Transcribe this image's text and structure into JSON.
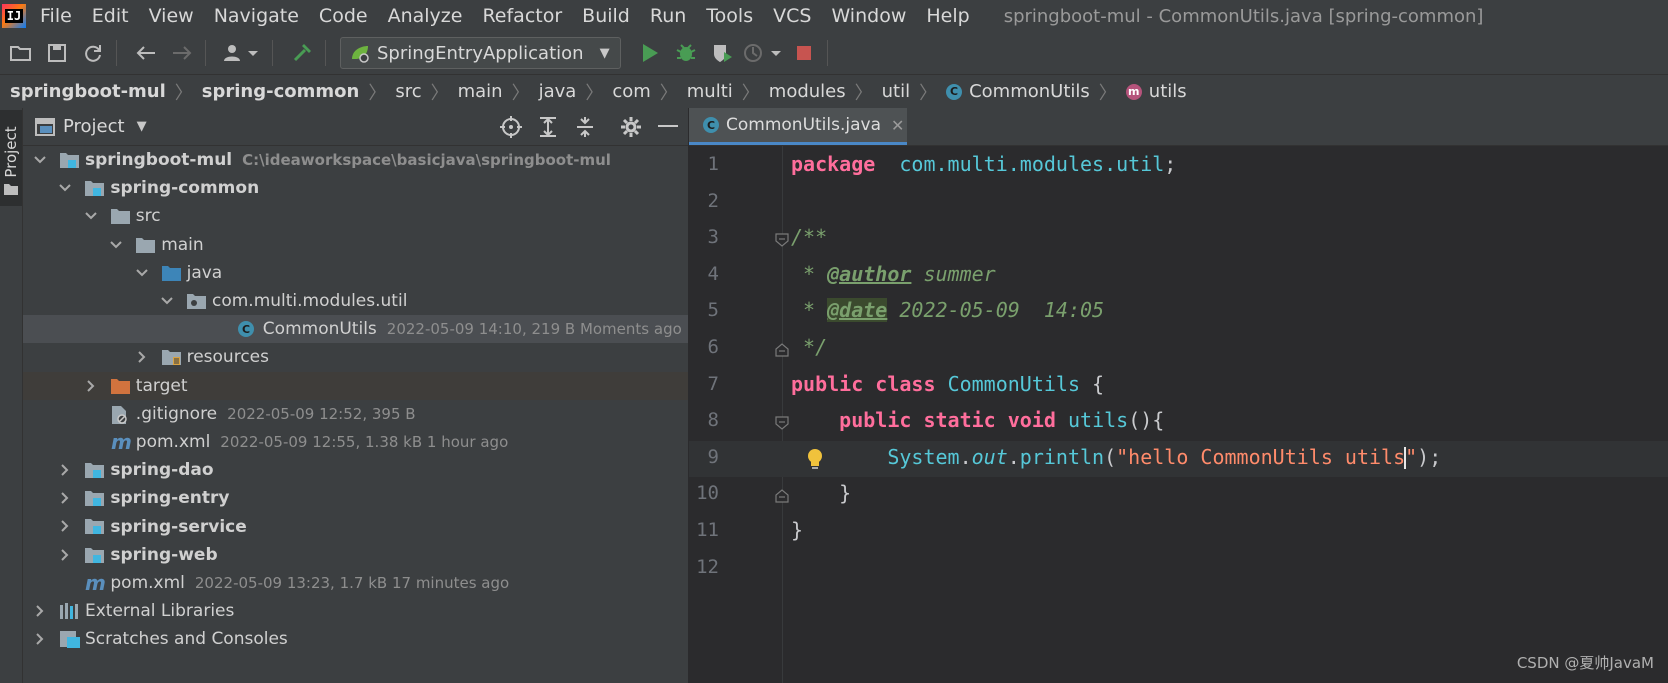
{
  "menu": {
    "items": [
      "File",
      "Edit",
      "View",
      "Navigate",
      "Code",
      "Analyze",
      "Refactor",
      "Build",
      "Run",
      "Tools",
      "VCS",
      "Window",
      "Help"
    ],
    "window_title": "springboot-mul - CommonUtils.java [spring-common]"
  },
  "toolbar": {
    "run_config": "SpringEntryApplication",
    "accent_run": "#499c54",
    "accent_stop": "#c75450"
  },
  "breadcrumb": [
    {
      "label": "springboot-mul",
      "bold": true
    },
    {
      "label": "spring-common",
      "bold": true
    },
    {
      "label": "src"
    },
    {
      "label": "main"
    },
    {
      "label": "java"
    },
    {
      "label": "com"
    },
    {
      "label": "multi"
    },
    {
      "label": "modules"
    },
    {
      "label": "util"
    },
    {
      "label": "CommonUtils",
      "icon": "class-icon"
    },
    {
      "label": "utils",
      "icon": "method-icon"
    }
  ],
  "side_tab": "Project",
  "project_panel": {
    "title": "Project",
    "tree": [
      {
        "depth": 0,
        "arrow": "down",
        "icon": "module",
        "label": "springboot-mul",
        "bold": true,
        "hint": "C:\\ideaworkspace\\basicjava\\springboot-mul"
      },
      {
        "depth": 1,
        "arrow": "down",
        "icon": "module",
        "label": "spring-common",
        "bold": true,
        "hint": ""
      },
      {
        "depth": 2,
        "arrow": "down",
        "icon": "folder",
        "label": "src",
        "hint": ""
      },
      {
        "depth": 3,
        "arrow": "down",
        "icon": "folder",
        "label": "main",
        "hint": ""
      },
      {
        "depth": 4,
        "arrow": "down",
        "icon": "source-folder",
        "label": "java",
        "hint": ""
      },
      {
        "depth": 5,
        "arrow": "down",
        "icon": "package",
        "label": "com.multi.modules.util",
        "hint": ""
      },
      {
        "depth": 7,
        "arrow": "",
        "icon": "class",
        "label": "CommonUtils",
        "hint": "2022-05-09 14:10, 219 B Moments ago",
        "selected": true
      },
      {
        "depth": 4,
        "arrow": "right",
        "icon": "resources-folder",
        "label": "resources",
        "hint": ""
      },
      {
        "depth": 2,
        "arrow": "right",
        "icon": "excluded-folder",
        "label": "target",
        "hint": "",
        "excluded": true
      },
      {
        "depth": 2,
        "arrow": "",
        "icon": "gitignore",
        "label": ".gitignore",
        "hint": "2022-05-09 12:52, 395 B"
      },
      {
        "depth": 2,
        "arrow": "",
        "icon": "maven",
        "label": "pom.xml",
        "hint": "2022-05-09 12:55, 1.38 kB 1 hour ago"
      },
      {
        "depth": 1,
        "arrow": "right",
        "icon": "module",
        "label": "spring-dao",
        "bold": true,
        "hint": ""
      },
      {
        "depth": 1,
        "arrow": "right",
        "icon": "module",
        "label": "spring-entry",
        "bold": true,
        "hint": ""
      },
      {
        "depth": 1,
        "arrow": "right",
        "icon": "module",
        "label": "spring-service",
        "bold": true,
        "hint": ""
      },
      {
        "depth": 1,
        "arrow": "right",
        "icon": "module",
        "label": "spring-web",
        "bold": true,
        "hint": ""
      },
      {
        "depth": 1,
        "arrow": "",
        "icon": "maven",
        "label": "pom.xml",
        "hint": "2022-05-09 13:23, 1.7 kB 17 minutes ago"
      },
      {
        "depth": 0,
        "arrow": "right",
        "icon": "libraries",
        "label": "External Libraries",
        "hint": ""
      },
      {
        "depth": 0,
        "arrow": "right",
        "icon": "scratches",
        "label": "Scratches and Consoles",
        "hint": ""
      }
    ]
  },
  "editor": {
    "tab_label": "CommonUtils.java",
    "tab_close": "✕",
    "current_line": 9,
    "lines": [
      {
        "n": "1",
        "tokens": [
          [
            "kw",
            "package"
          ],
          [
            "",
            "  "
          ],
          [
            "pkg",
            "com.multi.modules.util"
          ],
          [
            "",
            ";"
          ]
        ]
      },
      {
        "n": "2",
        "tokens": []
      },
      {
        "n": "3",
        "tokens": [
          [
            "com",
            "/**"
          ]
        ],
        "fold": "open"
      },
      {
        "n": "4",
        "tokens": [
          [
            "com",
            " * "
          ],
          [
            "tag",
            "@author"
          ],
          [
            "com",
            " summer"
          ]
        ]
      },
      {
        "n": "5",
        "tokens": [
          [
            "com",
            " * "
          ],
          [
            "tag hl",
            "@date"
          ],
          [
            "com",
            " 2022-05-09  14:05"
          ]
        ]
      },
      {
        "n": "6",
        "tokens": [
          [
            "com",
            " */"
          ]
        ],
        "fold": "close"
      },
      {
        "n": "7",
        "tokens": [
          [
            "kw",
            "public"
          ],
          [
            "",
            " "
          ],
          [
            "kw",
            "class"
          ],
          [
            "",
            " "
          ],
          [
            "cls",
            "CommonUtils"
          ],
          [
            "",
            " {"
          ]
        ]
      },
      {
        "n": "8",
        "tokens": [
          [
            "",
            "    "
          ],
          [
            "kw",
            "public"
          ],
          [
            "",
            " "
          ],
          [
            "kw",
            "static"
          ],
          [
            "",
            " "
          ],
          [
            "kw",
            "void"
          ],
          [
            "",
            " "
          ],
          [
            "mth",
            "utils"
          ],
          [
            "",
            "(){"
          ]
        ],
        "fold": "open"
      },
      {
        "n": "9",
        "tokens": [
          [
            "",
            "        "
          ],
          [
            "cls",
            "System"
          ],
          [
            "",
            "."
          ],
          [
            "fld",
            "out"
          ],
          [
            "",
            "."
          ],
          [
            "mth",
            "println"
          ],
          [
            "",
            "("
          ],
          [
            "str",
            "\"hello CommonUtils utils"
          ],
          [
            "caret",
            ""
          ],
          [
            "str",
            "\""
          ],
          [
            "",
            ");"
          ]
        ],
        "bulb": true
      },
      {
        "n": "10",
        "tokens": [
          [
            "",
            "    }"
          ]
        ],
        "fold": "close"
      },
      {
        "n": "11",
        "tokens": [
          [
            "",
            "}"
          ]
        ]
      },
      {
        "n": "12",
        "tokens": []
      }
    ]
  },
  "watermark": "CSDN @夏帅JavaM"
}
